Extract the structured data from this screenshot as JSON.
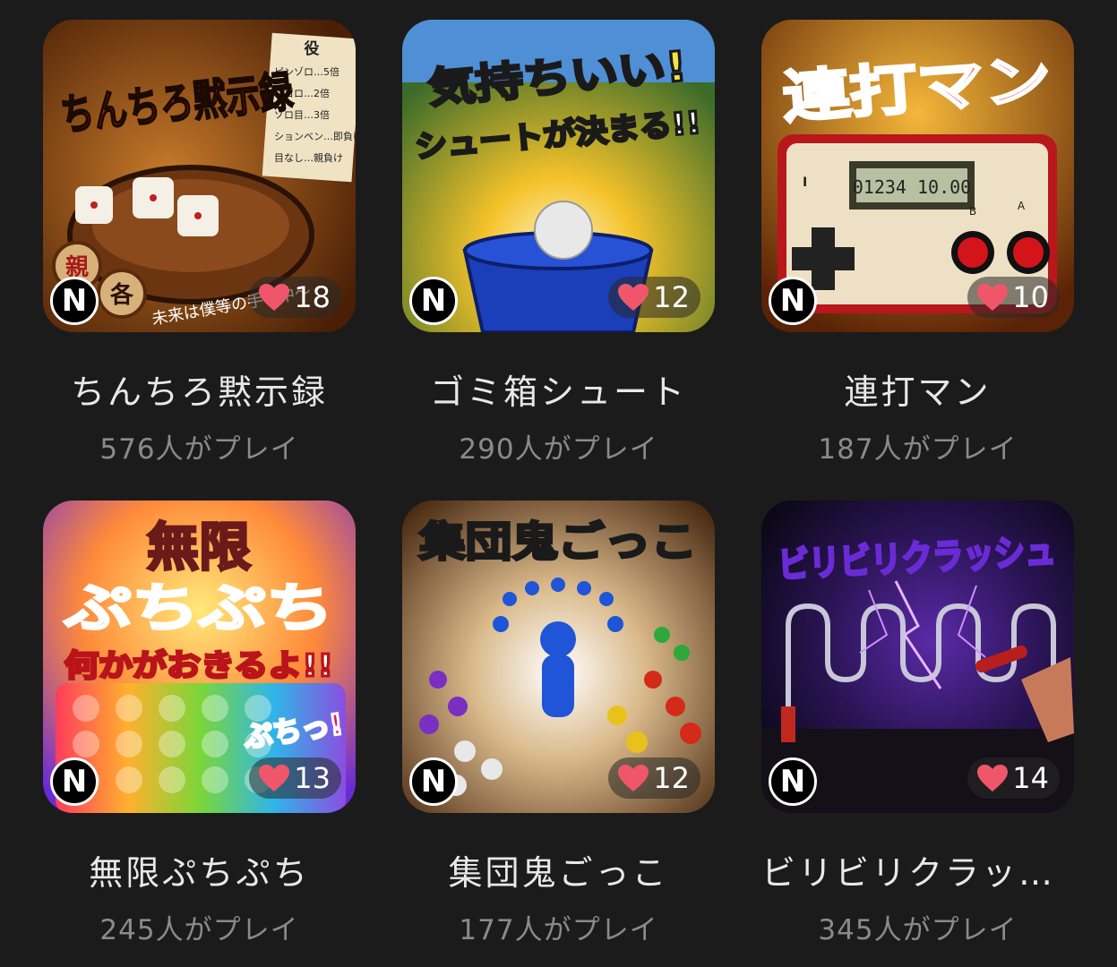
{
  "games": [
    {
      "title": "ちんちろ黙示録",
      "plays": "576人がプレイ",
      "likes": "18",
      "badge": "N",
      "art_title": "ちんちろ黙示録",
      "art_note": "未来は僕等の手の中〜",
      "rules_head": "役",
      "rules": [
        "ピンゾロ…5倍",
        "シゴロ…2倍",
        "ゾロ目…3倍",
        "ションベン…即負け",
        "目なし…親負け"
      ],
      "chip_a": "親",
      "chip_b": "各"
    },
    {
      "title": "ゴミ箱シュート",
      "plays": "290人がプレイ",
      "likes": "12",
      "badge": "N",
      "art_title": "気持ちいい!",
      "art_sub": "シュートが決まる!!"
    },
    {
      "title": "連打マン",
      "plays": "187人がプレイ",
      "likes": "10",
      "badge": "N",
      "art_title": "連打マン",
      "lcd": "01234 10.00",
      "btn_b": "B",
      "btn_a": "A",
      "btn_i": "I"
    },
    {
      "title": "無限ぷちぷち",
      "plays": "245人がプレイ",
      "likes": "13",
      "badge": "N",
      "art_title": "無限",
      "art_title2": "ぷちぷち",
      "art_sub": "何かがおきるよ!!",
      "art_pop": "ぷちっ!"
    },
    {
      "title": "集団鬼ごっこ",
      "plays": "177人がプレイ",
      "likes": "12",
      "badge": "N",
      "art_title": "集団鬼ごっこ"
    },
    {
      "title": "ビリビリクラッシュ",
      "plays": "345人がプレイ",
      "likes": "14",
      "badge": "N",
      "art_title": "ビリビリクラッシュ"
    }
  ],
  "colors": {
    "background": "#1b1b1b",
    "heart": "#f0566a",
    "plays_text": "#8a8a8a"
  }
}
